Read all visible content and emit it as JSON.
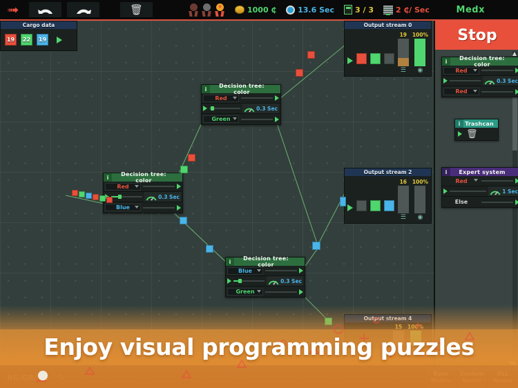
{
  "topbar": {
    "tools": [
      {
        "name": "cursor-tool",
        "glyph": "cursor"
      },
      {
        "name": "undo-button",
        "glyph": "undo"
      },
      {
        "name": "redo-button",
        "glyph": "redo"
      },
      {
        "name": "delete-button",
        "glyph": "trash"
      }
    ],
    "medals": [
      {
        "label": "bronze-medal",
        "color": "#6b3b33",
        "earned": false
      },
      {
        "label": "silver-medal",
        "color": "#6e6e6e",
        "earned": false
      },
      {
        "label": "gold-medal",
        "color": "#f0a32a",
        "earned": true
      }
    ],
    "money": "1000 ₵",
    "time": "13.6 Sec",
    "crates": "3 / 3",
    "rate": "2 ₵/ Sec",
    "user": "Medx"
  },
  "sidebar": {
    "stop_label": "Stop",
    "nodes": [
      {
        "title": "Decision tree: color",
        "type": "decision-tree",
        "rows": [
          {
            "value": "Red",
            "color": "red"
          },
          {
            "value": "0.3 Sec",
            "type": "gauge"
          },
          {
            "value": "Red",
            "color": "red"
          }
        ]
      },
      {
        "title": "Trashcan",
        "type": "trashcan"
      },
      {
        "title": "Expert system",
        "type": "expert-system",
        "rows": [
          {
            "value": "Red",
            "color": "red"
          },
          {
            "value": "1 Sec",
            "type": "gauge"
          },
          {
            "value": "Else",
            "color": "white"
          }
        ]
      }
    ]
  },
  "canvas": {
    "cargo_panel": {
      "title": "Cargo data",
      "items": [
        {
          "label": "19",
          "color": "#e8503c"
        },
        {
          "label": "22",
          "color": "#4fd66e"
        },
        {
          "label": "19",
          "color": "#4ab4e8"
        }
      ]
    },
    "nodes": [
      {
        "id": "node-top",
        "title": "Decision tree: color",
        "rows": [
          {
            "value": "Red",
            "color": "red"
          },
          {
            "value": "0.3 Sec",
            "type": "gauge"
          },
          {
            "value": "Green",
            "color": "green"
          }
        ]
      },
      {
        "id": "node-left",
        "title": "Decision tree: color",
        "rows": [
          {
            "value": "Red",
            "color": "red"
          },
          {
            "value": "0.3 Sec",
            "type": "gauge"
          },
          {
            "value": "Blue",
            "color": "blue"
          }
        ]
      },
      {
        "id": "node-bottom",
        "title": "Decision tree: color",
        "rows": [
          {
            "value": "Blue",
            "color": "blue"
          },
          {
            "value": "0.3 Sec",
            "type": "gauge"
          },
          {
            "value": "Green",
            "color": "green"
          }
        ]
      }
    ],
    "outputs": [
      {
        "id": "output-0",
        "title": "Output stream 0",
        "swatches": [
          "#e8503c",
          "#4fd66e",
          "#4e5755"
        ],
        "count": "19",
        "percent": "100%",
        "count_fill": "#b0823f",
        "count_fill_pct": 30,
        "percent_fill": "#4fd66e",
        "percent_fill_pct": 100
      },
      {
        "id": "output-2",
        "title": "Output stream 2",
        "swatches": [
          "#4e5755",
          "#4fd66e",
          "#4ab4e8"
        ],
        "count": "16",
        "percent": "100%",
        "count_fill": "#b0823f",
        "count_fill_pct": 0,
        "percent_fill": "#4fd66e",
        "percent_fill_pct": 0
      },
      {
        "id": "output-4",
        "title": "Output stream 4",
        "count": "15",
        "percent": "100%"
      }
    ]
  },
  "bottombar": {
    "puzzle_code": "RG/GB/RG",
    "tabs": [
      {
        "line1": "Base",
        "line2": "Nodes"
      },
      {
        "line1": "Custom",
        "line2": "Nodes"
      },
      {
        "line1": "DLL",
        "line2": "Nodes"
      }
    ]
  },
  "promo": {
    "headline": "Enjoy visual programming puzzles"
  }
}
